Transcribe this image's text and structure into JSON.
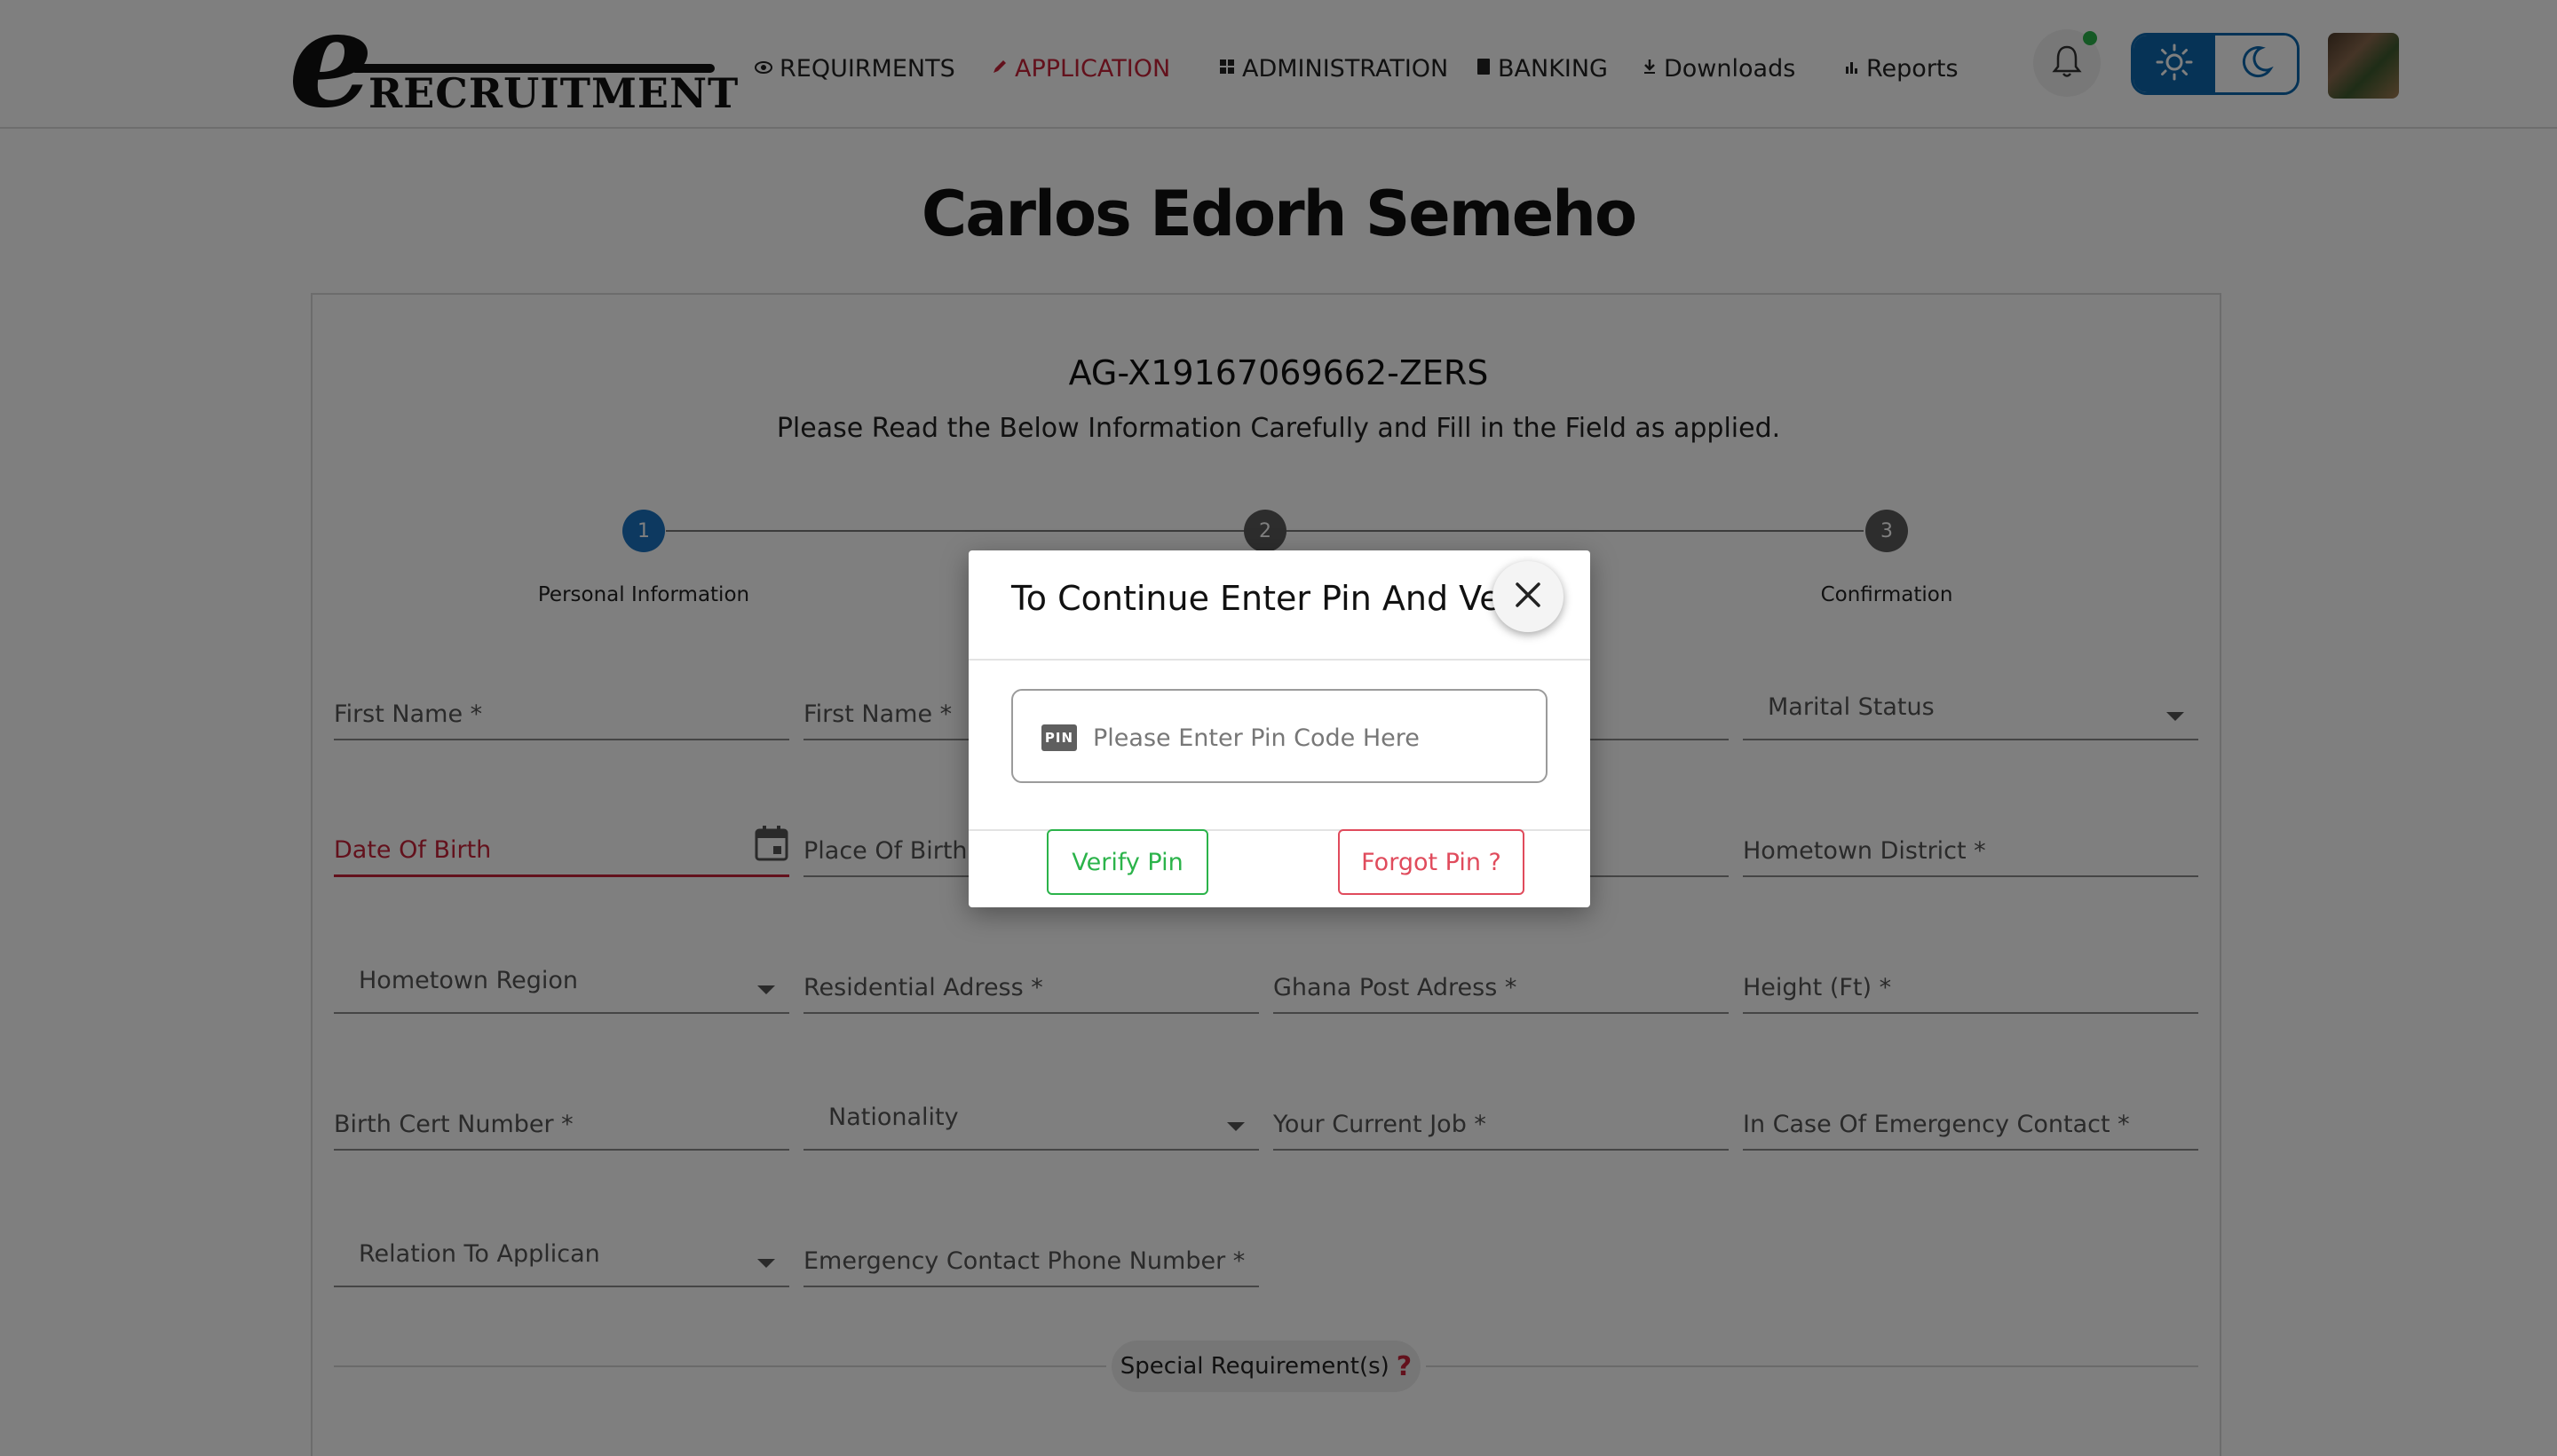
{
  "app": {
    "logo_letter": "e",
    "logo_word": "RECRUITMENT"
  },
  "nav": {
    "items": [
      {
        "label": "REQUIRMENTS",
        "icon": "eye-icon"
      },
      {
        "label": "APPLICATION",
        "icon": "pencil-icon",
        "active": true
      },
      {
        "label": "ADMINISTRATION",
        "icon": "grid-icon"
      },
      {
        "label": "BANKING",
        "icon": "bank-icon"
      },
      {
        "label": "Downloads",
        "icon": "download-icon"
      },
      {
        "label": "Reports",
        "icon": "bar-chart-icon"
      }
    ],
    "notification_has_unread": true,
    "theme_mode": "light"
  },
  "page": {
    "title": "Carlos Edorh Semeho",
    "application_id": "AG-X19167069662-ZERS",
    "instructions": "Please Read the Below Information Carefully and Fill in the Field as applied."
  },
  "steps": [
    {
      "number": "1",
      "label": "Personal Information",
      "status": "active"
    },
    {
      "number": "2",
      "label": "",
      "status": "inactive"
    },
    {
      "number": "3",
      "label": "Confirmation",
      "status": "inactive"
    }
  ],
  "form": {
    "fields": [
      {
        "label": "First Name *",
        "type": "text"
      },
      {
        "label": "First Name *",
        "type": "text"
      },
      {
        "label": "",
        "type": "text"
      },
      {
        "label": "Marital Status",
        "type": "select"
      },
      {
        "label": "Date Of Birth",
        "type": "date",
        "error": true
      },
      {
        "label": "Place Of Birth *",
        "type": "text"
      },
      {
        "label": "",
        "type": "text"
      },
      {
        "label": "Hometown District *",
        "type": "text"
      },
      {
        "label": "Hometown Region",
        "type": "select"
      },
      {
        "label": "Residential Adress *",
        "type": "text"
      },
      {
        "label": "Ghana Post Adress *",
        "type": "text"
      },
      {
        "label": "Height (Ft) *",
        "type": "text"
      },
      {
        "label": "Birth Cert Number *",
        "type": "text"
      },
      {
        "label": "Nationality",
        "type": "select"
      },
      {
        "label": "Your Current Job *",
        "type": "text"
      },
      {
        "label": "In Case Of Emergency Contact *",
        "type": "text"
      },
      {
        "label": "Relation To Applican",
        "type": "select"
      },
      {
        "label": "Emergency Contact Phone Number *",
        "type": "text"
      }
    ],
    "special_requirements_label": "Special Requirement(s)"
  },
  "modal": {
    "title": "To Continue Enter Pin And Verify",
    "pin_badge": "PIN",
    "pin_placeholder": "Please Enter Pin Code Here",
    "pin_value": "",
    "verify_label": "Verify Pin",
    "forgot_label": "Forgot Pin ?"
  },
  "colors": {
    "accent_red": "#c62239",
    "primary_blue": "#0c67ad",
    "success_green": "#2bb34a",
    "overlay": "rgba(0,0,0,0.5)"
  }
}
